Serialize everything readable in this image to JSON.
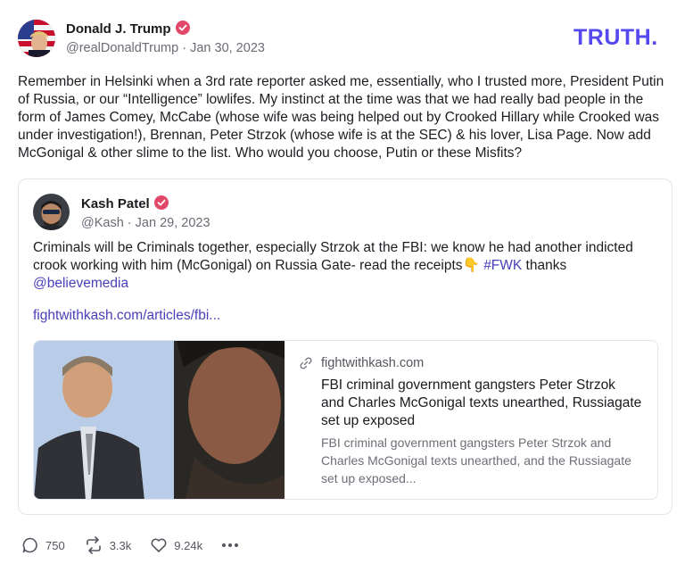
{
  "brand": {
    "logo_text": "TRUTH.",
    "accent": "#5448ee",
    "link_color": "#4a3fb8"
  },
  "post": {
    "author_name": "Donald J. Trump",
    "handle": "@realDonaldTrump",
    "date": "Jan 30, 2023",
    "text": "Remember in Helsinki when a 3rd rate reporter asked me, essentially, who I trusted more, President Putin of Russia, or our “Intelligence” lowlifes. My instinct at the time was that we had really bad people in the form of James Comey, McCabe (whose wife was being helped out by Crooked Hillary while Crooked was under investigation!), Brennan, Peter Strzok (whose wife is at the SEC) & his lover, Lisa Page. Now add McGonigal & other slime to the list. Who would you choose, Putin or these Misfits?"
  },
  "quote": {
    "author_name": "Kash Patel",
    "handle": "@Kash",
    "date": "Jan 29, 2023",
    "text_before": "Criminals will be Criminals together, especially Strzok at the FBI: we know he had another indicted crook working with him (McGonigal) on Russia Gate- read the receipts",
    "emoji": "👇",
    "hashtag": "#FWK",
    "text_after": " thanks",
    "mention": "@believemedia",
    "url": "fightwithkash.com/articles/fbi...",
    "card": {
      "domain": "fightwithkash.com",
      "title": "FBI criminal government gangsters Peter Strzok and Charles McGonigal texts unearthed, Russiagate set up exposed",
      "description": "FBI criminal government gangsters Peter Strzok and Charles McGonigal texts unearthed, and the Russiagate set up exposed..."
    }
  },
  "actions": {
    "replies": "750",
    "retruths": "3.3k",
    "likes": "9.24k",
    "more": "more-options"
  },
  "icons": [
    "verified-badge-icon",
    "link-icon",
    "reply-icon",
    "retruth-icon",
    "heart-icon",
    "more-icon"
  ]
}
